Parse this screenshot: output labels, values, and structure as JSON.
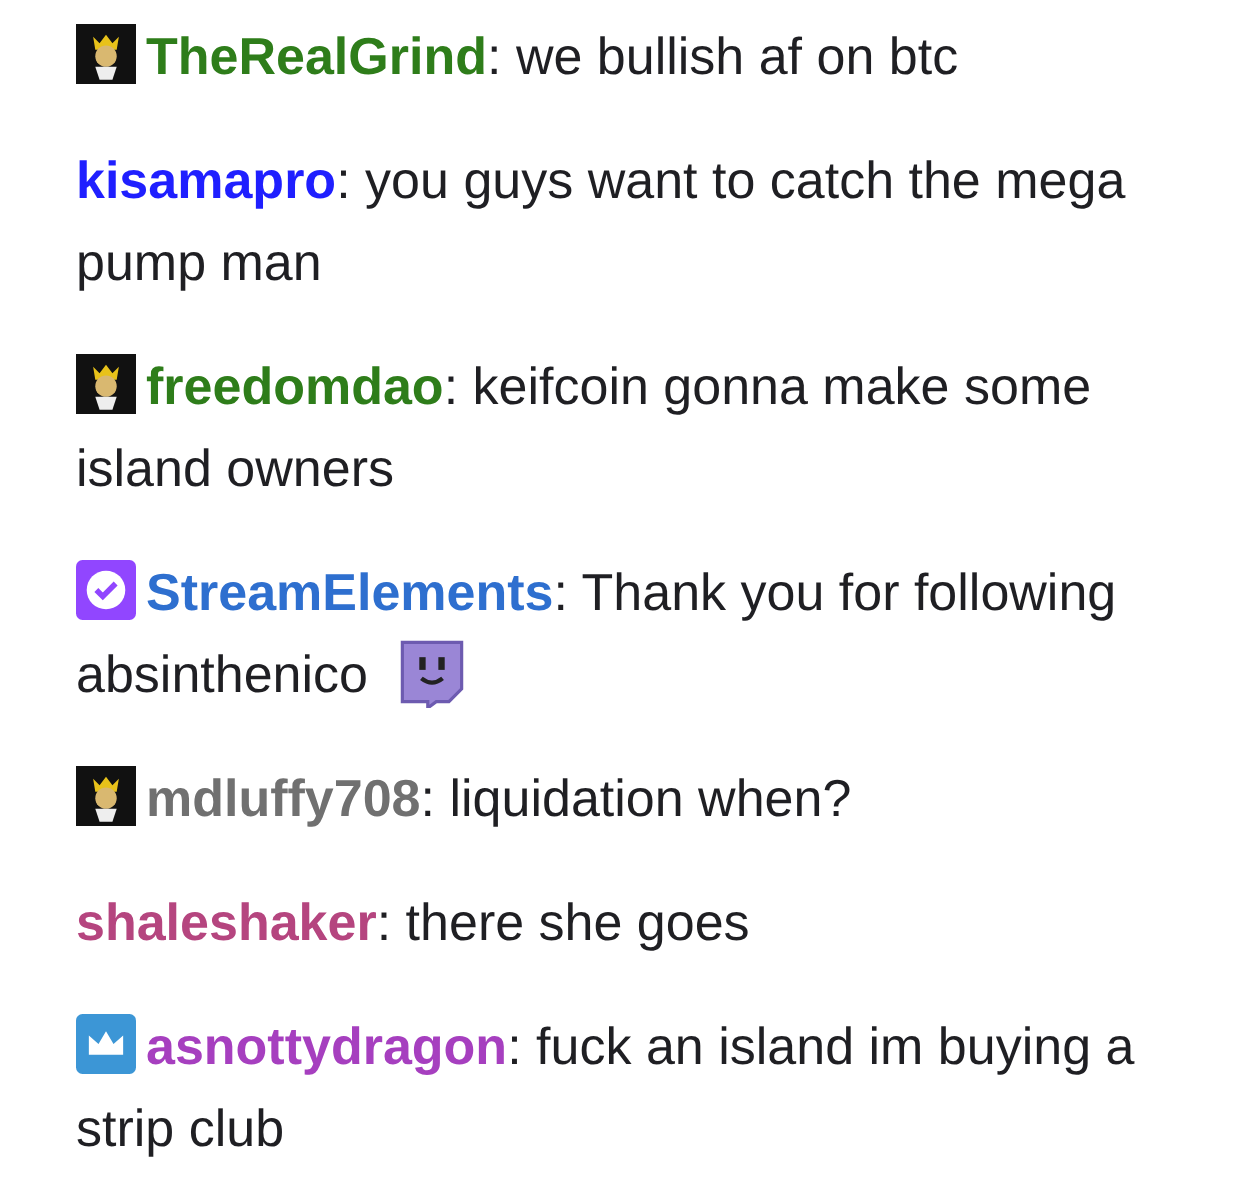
{
  "messages": [
    {
      "kind": "king",
      "username": "TheRealGrind",
      "color": "#2e7d1a",
      "separator": ":",
      "text": "we bullish af on btc",
      "emote": false
    },
    {
      "kind": "plain",
      "username": "kisamapro",
      "color": "#1f1fff",
      "separator": ":",
      "text": "you guys want to catch the mega pump man",
      "emote": false
    },
    {
      "kind": "king",
      "username": "freedomdao",
      "color": "#2e7d1a",
      "separator": ":",
      "text": "keifcoin gonna make some island owners",
      "emote": false
    },
    {
      "kind": "verified",
      "username": "StreamElements",
      "color": "#2e6fcf",
      "separator": ":",
      "text": "Thank you for following absinthenico",
      "emote": true
    },
    {
      "kind": "king",
      "username": "mdluffy708",
      "color": "#707070",
      "separator": ":",
      "text": "liquidation when?",
      "emote": false
    },
    {
      "kind": "plain",
      "username": "shaleshaker",
      "color": "#b5457f",
      "separator": ":",
      "text": "there she goes",
      "emote": false
    },
    {
      "kind": "crown",
      "username": "asnottydragon",
      "color": "#a63fbf",
      "separator": ":",
      "text": "fuck an island im buying a strip club",
      "emote": false
    }
  ]
}
